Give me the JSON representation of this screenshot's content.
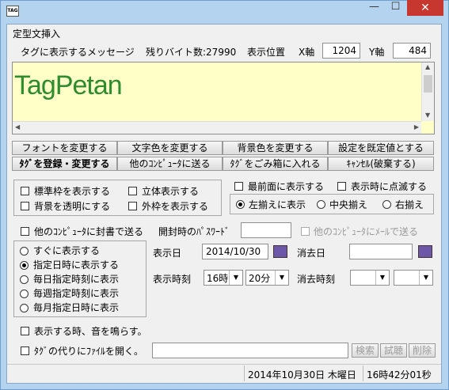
{
  "window": {
    "app_icon_text": "TAG",
    "minimize": "—",
    "maximize": "☐",
    "close": "✕"
  },
  "menu": {
    "item": "定型文挿入"
  },
  "header": {
    "message_label": "タグに表示するメッセージ",
    "remaining_label": "残りバイト数:27990",
    "position_label": "表示位置",
    "x_label": "X軸",
    "x_value": "1204",
    "y_label": "Y軸",
    "y_value": "484"
  },
  "editor": {
    "text": "TagPetan",
    "text_color": "#2e8b2e",
    "background": "#ffffc8"
  },
  "buttons": {
    "change_font": "フォントを変更する",
    "change_text_color": "文字色を変更する",
    "change_bg_color": "背景色を変更する",
    "set_default": "設定を既定値とする",
    "register_change": "ﾀｸﾞを登録・変更する",
    "send_other_pc": "他のｺﾝﾋﾟｭｰﾀに送る",
    "trash": "ﾀｸﾞをごみ箱に入れる",
    "cancel": "ｷｬﾝｾﾙ(破棄する)",
    "search": "検索",
    "preview": "試聴",
    "delete": "削除"
  },
  "style_options": {
    "show_border": "標準枠を表示する",
    "stereo": "立体表示する",
    "transparent_bg": "背景を透明にする",
    "outline": "外枠を表示する"
  },
  "top_options": {
    "topmost": "最前面に表示する",
    "blink": "表示時に点滅する"
  },
  "align": {
    "left": "左揃えに表示",
    "center": "中央揃え",
    "right": "右揃え"
  },
  "sealed": {
    "label": "他のｺﾝﾋﾟｭｰﾀに封書で送る",
    "password_label": "開封時のﾊﾟｽﾜｰﾄﾞ",
    "password_value": "",
    "mail_label": "他のｺﾝﾋﾟｭｰﾀにﾒｰﾙで送る"
  },
  "schedule": {
    "now": "すぐに表示する",
    "specified": "指定日時に表示する",
    "daily": "毎日指定時刻に表示",
    "weekly": "毎週指定時刻に表示",
    "monthly": "毎月指定日時に表示"
  },
  "datetime": {
    "show_date_label": "表示日",
    "show_date_value": "2014/10/30",
    "erase_date_label": "消去日",
    "erase_date_value": "",
    "show_time_label": "表示時刻",
    "show_hour": "16時",
    "show_minute": "20分",
    "erase_time_label": "消去時刻",
    "erase_hour": "",
    "erase_minute": ""
  },
  "sound": {
    "label": "表示する時、音を鳴らす。"
  },
  "file": {
    "label": "ﾀｸﾞの代りにﾌｧｲﾙを開く。",
    "value": ""
  },
  "status": {
    "date": "2014年10月30日 木曜日",
    "time": "16時42分01秒"
  }
}
